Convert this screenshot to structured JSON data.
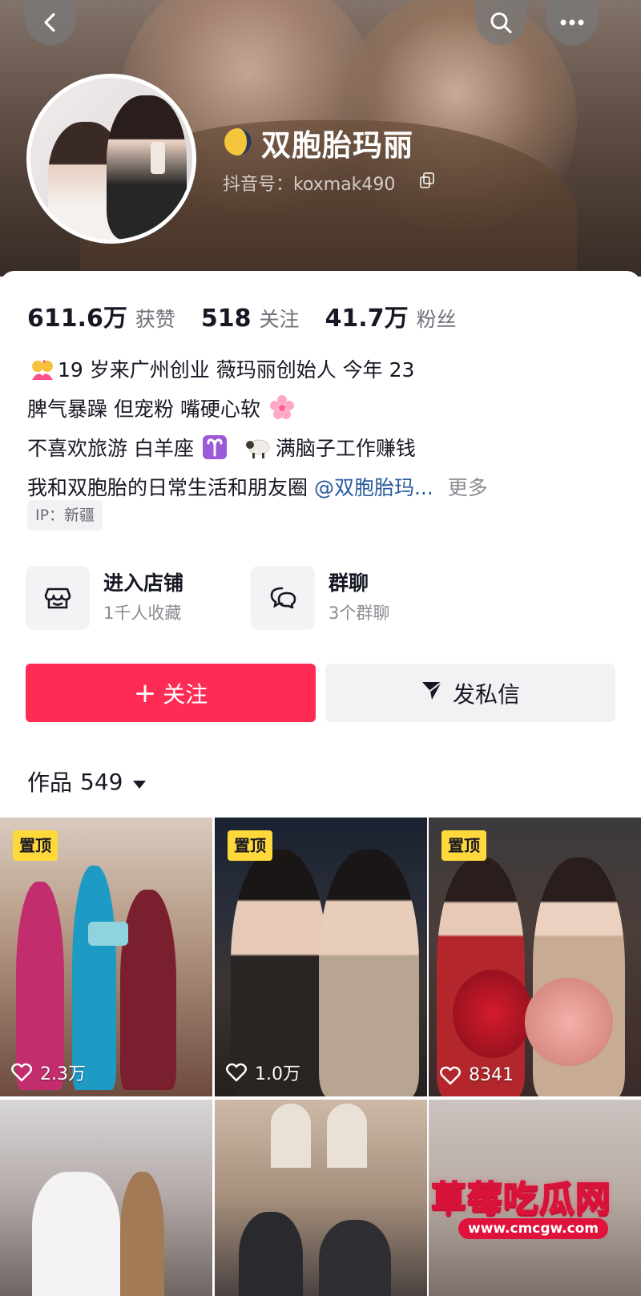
{
  "header": {
    "nickname": "双胞胎玛丽",
    "douyin_id": "抖音号：koxmak490",
    "icons": [
      "back-icon",
      "search-icon",
      "more-icon",
      "moon-icon",
      "copy-icon"
    ]
  },
  "stats": [
    {
      "value": "611.6万",
      "label": "获赞"
    },
    {
      "value": "518",
      "label": "关注"
    },
    {
      "value": "41.7万",
      "label": "粉丝"
    }
  ],
  "bio": {
    "line1": "19 岁来广州创业  薇玛丽创始人  今年 23",
    "line2": "脾气暴躁 但宠粉  嘴硬心软",
    "line3a": "不喜欢旅游 白羊座",
    "line3b": "满脑子工作赚钱",
    "line4": "我和双胞胎的日常生活和朋友圈",
    "mention": "@双胞胎玛...",
    "more": "更多",
    "emojis": [
      "couple-kiss-emoji",
      "cherry-blossom-emoji",
      "aries-emoji",
      "sheep-emoji"
    ]
  },
  "ip_tag": "IP：新疆",
  "entries": [
    {
      "title": "进入店铺",
      "sub": "1千人收藏",
      "icon": "store-icon"
    },
    {
      "title": "群聊",
      "sub": "3个群聊",
      "icon": "group-chat-icon"
    }
  ],
  "buttons": {
    "follow": "关注",
    "message": "发私信"
  },
  "works": {
    "label": "作品",
    "count": "549"
  },
  "videos": [
    {
      "pinned": "置顶",
      "likes": "2.3万"
    },
    {
      "pinned": "置顶",
      "likes": "1.0万"
    },
    {
      "pinned": "置顶",
      "likes": "8341"
    },
    {
      "pinned": "",
      "likes": ""
    },
    {
      "pinned": "",
      "likes": ""
    },
    {
      "pinned": "",
      "likes": ""
    }
  ],
  "watermark": {
    "title": "草莓吃瓜网",
    "url": "www.cmcgw.com"
  },
  "colors": {
    "accent": "#fe2c55",
    "pin": "#ffd83b",
    "mention": "#2a5b9c"
  }
}
